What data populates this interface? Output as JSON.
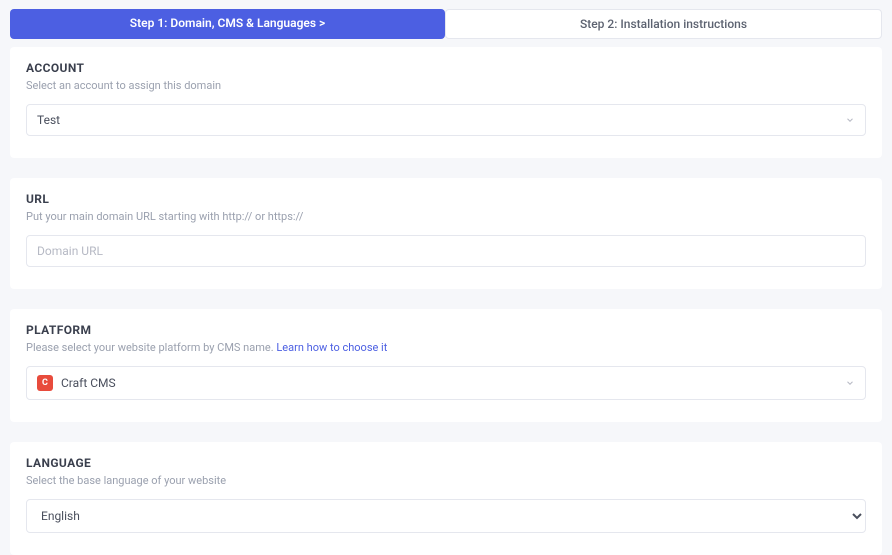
{
  "tabs": {
    "step1": "Step 1: Domain, CMS & Languages  >",
    "step2": "Step 2: Installation instructions"
  },
  "account": {
    "title": "ACCOUNT",
    "sub": "Select an account to assign this domain",
    "value": "Test"
  },
  "url": {
    "title": "URL",
    "sub": "Put your main domain URL starting with http:// or https://",
    "placeholder": "Domain URL",
    "value": ""
  },
  "platform": {
    "title": "PLATFORM",
    "sub_prefix": "Please select your website platform by CMS name. ",
    "link": "Learn how to choose it",
    "icon_letter": "C",
    "value": "Craft CMS"
  },
  "language": {
    "title": "LANGUAGE",
    "sub": "Select the base language of your website",
    "value": "English"
  }
}
